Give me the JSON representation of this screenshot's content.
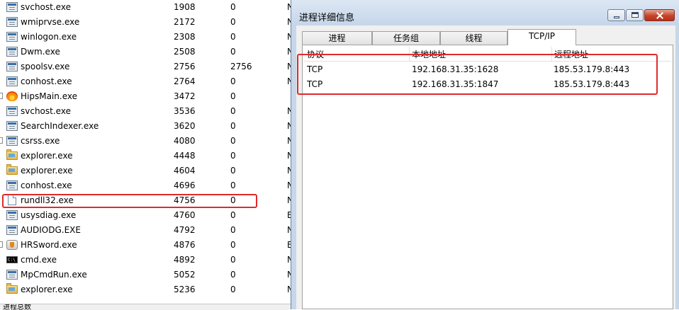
{
  "process_list": {
    "rows": [
      {
        "name": "svchost.exe",
        "pid": "1908",
        "parent": "0",
        "extra": "N",
        "icon": "app-icon",
        "expand": false
      },
      {
        "name": "wmiprvse.exe",
        "pid": "2172",
        "parent": "0",
        "extra": "N",
        "icon": "app-icon",
        "expand": false
      },
      {
        "name": "winlogon.exe",
        "pid": "2308",
        "parent": "0",
        "extra": "N",
        "icon": "app-icon",
        "expand": false
      },
      {
        "name": "Dwm.exe",
        "pid": "2508",
        "parent": "0",
        "extra": "N",
        "icon": "app-icon",
        "expand": false
      },
      {
        "name": "spoolsv.exe",
        "pid": "2756",
        "parent": "2756",
        "extra": "N",
        "icon": "app-icon",
        "expand": false
      },
      {
        "name": "conhost.exe",
        "pid": "2764",
        "parent": "0",
        "extra": "N",
        "icon": "app-icon",
        "expand": false
      },
      {
        "name": "HipsMain.exe",
        "pid": "3472",
        "parent": "0",
        "extra": "",
        "icon": "flame-icon",
        "expand": true
      },
      {
        "name": "svchost.exe",
        "pid": "3536",
        "parent": "0",
        "extra": "N",
        "icon": "app-icon",
        "expand": false
      },
      {
        "name": "SearchIndexer.exe",
        "pid": "3620",
        "parent": "0",
        "extra": "N",
        "icon": "app-icon",
        "expand": false
      },
      {
        "name": "csrss.exe",
        "pid": "4080",
        "parent": "0",
        "extra": "N",
        "icon": "app-icon",
        "expand": true
      },
      {
        "name": "explorer.exe",
        "pid": "4448",
        "parent": "0",
        "extra": "N",
        "icon": "folder-icon",
        "expand": false
      },
      {
        "name": "explorer.exe",
        "pid": "4604",
        "parent": "0",
        "extra": "N",
        "icon": "folder-icon",
        "expand": false
      },
      {
        "name": "conhost.exe",
        "pid": "4696",
        "parent": "0",
        "extra": "N",
        "icon": "app-icon",
        "expand": false
      },
      {
        "name": "rundll32.exe",
        "pid": "4756",
        "parent": "0",
        "extra": "N",
        "icon": "document-icon",
        "expand": false
      },
      {
        "name": "usysdiag.exe",
        "pid": "4760",
        "parent": "0",
        "extra": "E",
        "icon": "app-icon",
        "expand": false
      },
      {
        "name": "AUDIODG.EXE",
        "pid": "4792",
        "parent": "0",
        "extra": "N",
        "icon": "app-icon",
        "expand": false
      },
      {
        "name": "HRSword.exe",
        "pid": "4876",
        "parent": "0",
        "extra": "E",
        "icon": "shield-icon",
        "expand": true
      },
      {
        "name": "cmd.exe",
        "pid": "4892",
        "parent": "0",
        "extra": "N",
        "icon": "cmd-icon",
        "expand": false
      },
      {
        "name": "MpCmdRun.exe",
        "pid": "5052",
        "parent": "0",
        "extra": "N",
        "icon": "app-icon",
        "expand": false
      },
      {
        "name": "explorer.exe",
        "pid": "5236",
        "parent": "0",
        "extra": "N",
        "icon": "folder-icon",
        "expand": false
      }
    ],
    "status_text": "进程总数"
  },
  "dialog": {
    "title": "进程详细信息",
    "tabs": [
      "进程",
      "任务组",
      "线程",
      "TCP/IP"
    ],
    "active_tab": "TCP/IP",
    "tcp": {
      "headers": [
        "协议",
        "本地地址",
        "远程地址"
      ],
      "rows": [
        {
          "proto": "TCP",
          "local": "192.168.31.35:1628",
          "remote": "185.53.179.8:443"
        },
        {
          "proto": "TCP",
          "local": "192.168.31.35:1847",
          "remote": "185.53.179.8:443"
        }
      ]
    }
  },
  "colors": {
    "highlight_border": "#e02a2a",
    "dialog_frame": "#c6d7ea",
    "panel_bg": "#f0f0f0"
  }
}
